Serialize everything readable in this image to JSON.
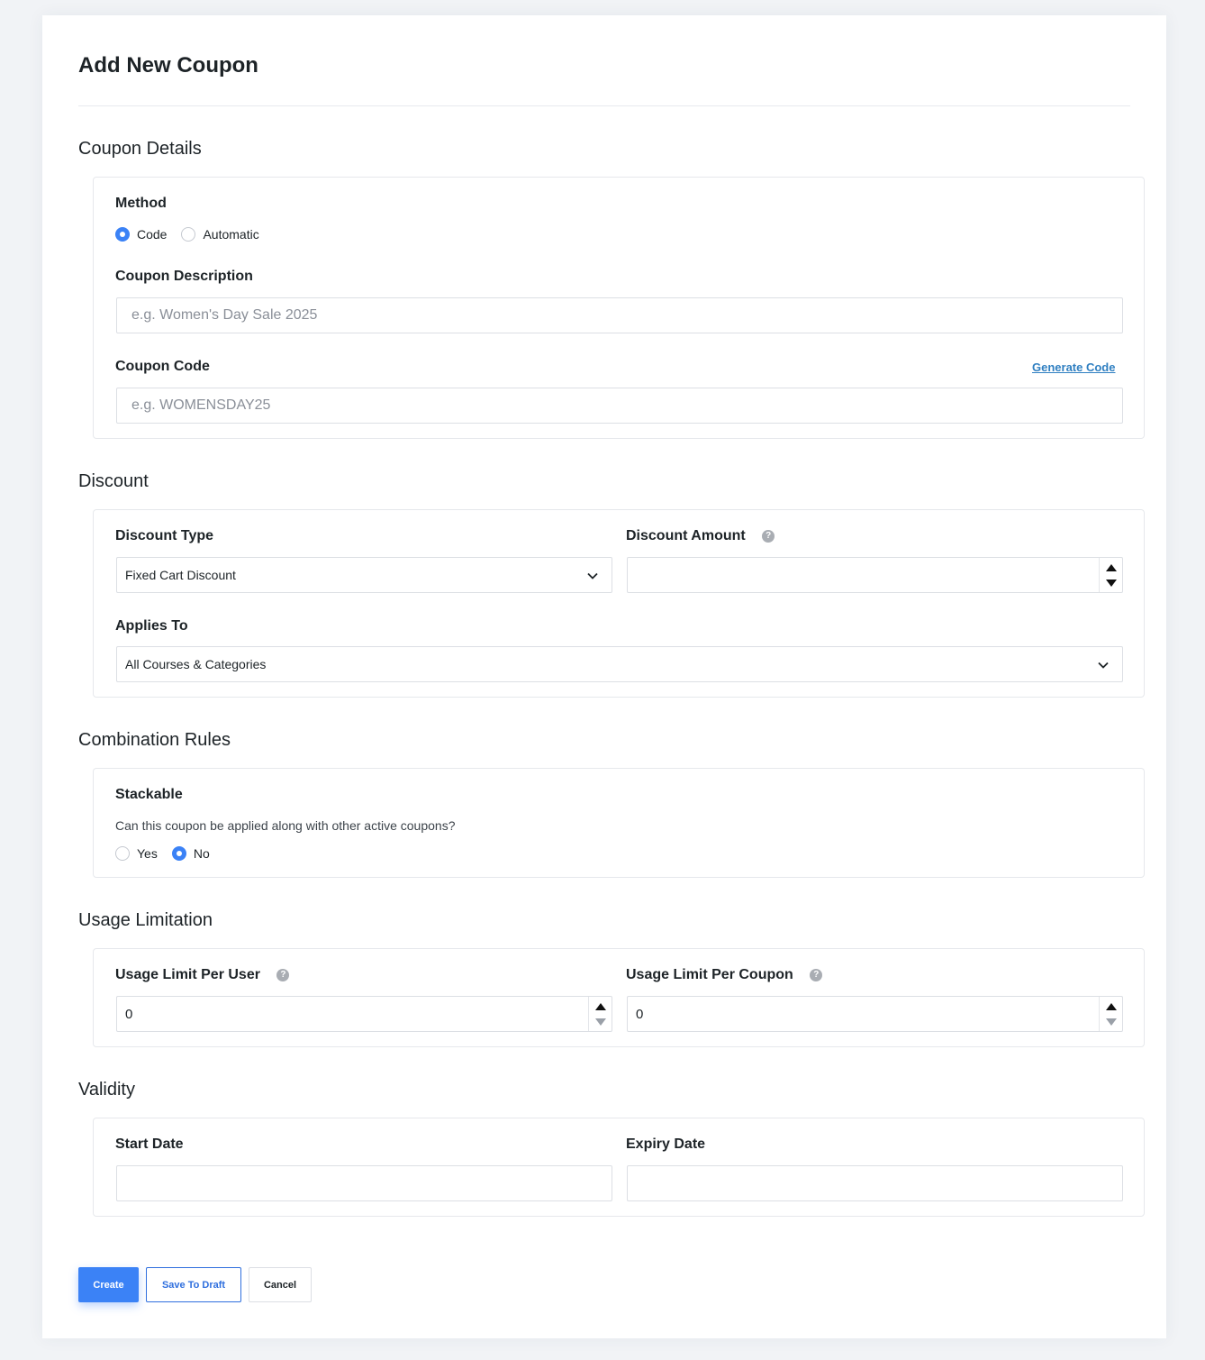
{
  "page": {
    "title": "Add New Coupon"
  },
  "coupon_details": {
    "section_title": "Coupon Details",
    "method": {
      "label": "Method",
      "options": [
        {
          "label": "Code",
          "selected": true
        },
        {
          "label": "Automatic",
          "selected": false
        }
      ]
    },
    "description": {
      "label": "Coupon Description",
      "placeholder": "e.g. Women's Day Sale 2025"
    },
    "code": {
      "label": "Coupon Code",
      "placeholder": "e.g. WOMENSDAY25",
      "generate_link": "Generate Code"
    }
  },
  "discount": {
    "section_title": "Discount",
    "type": {
      "label": "Discount Type",
      "value": "Fixed Cart Discount"
    },
    "amount": {
      "label": "Discount Amount",
      "value": "",
      "help_icon": "question-icon"
    },
    "applies_to": {
      "label": "Applies To",
      "value": "All Courses & Categories"
    }
  },
  "combination_rules": {
    "section_title": "Combination Rules",
    "stackable": {
      "label": "Stackable",
      "description": "Can this coupon be applied along with other active coupons?",
      "options": [
        {
          "label": "Yes",
          "selected": false
        },
        {
          "label": "No",
          "selected": true
        }
      ]
    }
  },
  "usage_limitation": {
    "section_title": "Usage Limitation",
    "per_user": {
      "label": "Usage Limit Per User",
      "value": "0"
    },
    "per_coupon": {
      "label": "Usage Limit Per Coupon",
      "value": "0"
    }
  },
  "validity": {
    "section_title": "Validity",
    "start_date": {
      "label": "Start Date",
      "value": ""
    },
    "expiry_date": {
      "label": "Expiry Date",
      "value": ""
    }
  },
  "actions": {
    "create": "Create",
    "save_draft": "Save To Draft",
    "cancel": "Cancel"
  },
  "colors": {
    "accent": "#3b82f6",
    "link": "#2f7fc1",
    "background": "#f1f3f6"
  }
}
